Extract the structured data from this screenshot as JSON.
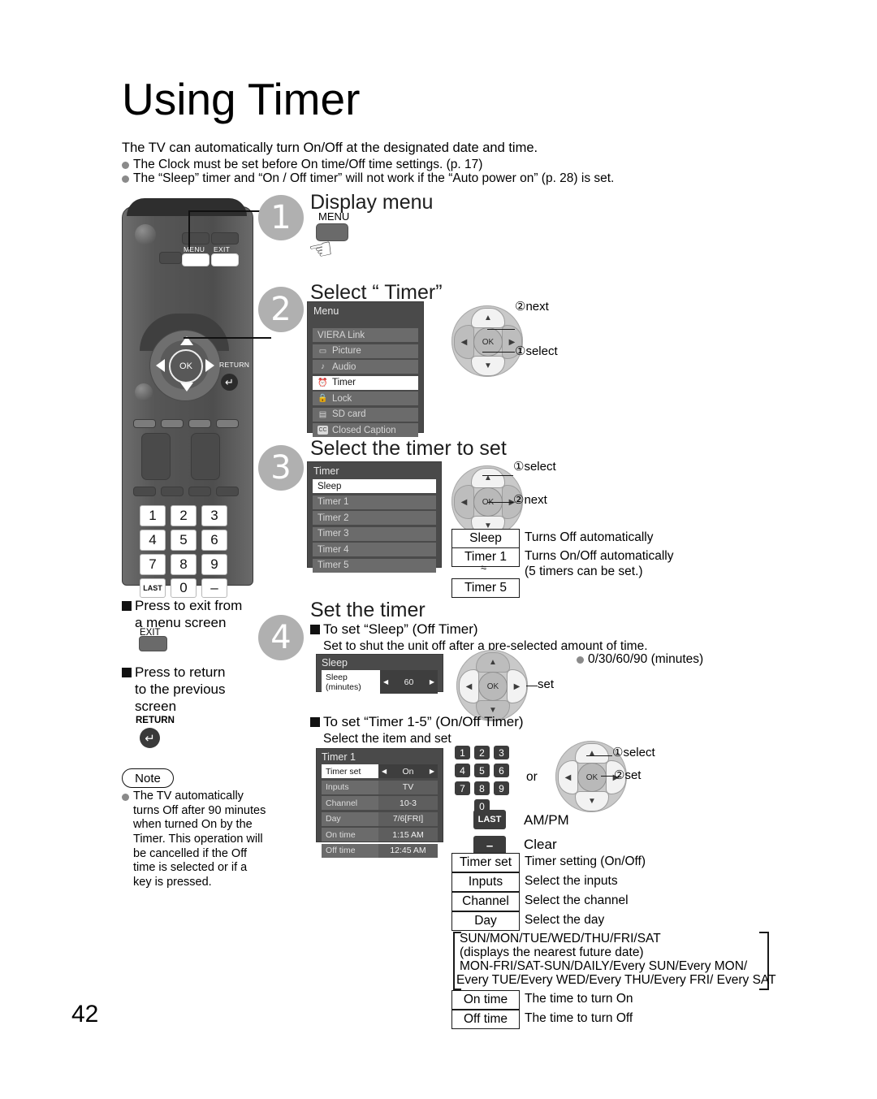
{
  "page": {
    "title": "Using Timer",
    "number": "42",
    "intro": "The TV can automatically turn On/Off at the designated date and time.",
    "intro_bullets": [
      "The Clock must be set before On time/Off time settings. (p. 17)",
      "The “Sleep” timer and “On / Off timer” will not work if the “Auto power on” (p. 28) is set."
    ]
  },
  "remote": {
    "menu_label": "MENU",
    "exit_label": "EXIT",
    "return_label": "RETURN",
    "ok_label": "OK",
    "keys": [
      "1",
      "2",
      "3",
      "4",
      "5",
      "6",
      "7",
      "8",
      "9",
      "LAST",
      "0",
      "–"
    ]
  },
  "steps": [
    {
      "num": "1",
      "title": "Display menu",
      "key_label": "MENU"
    },
    {
      "num": "2",
      "title": "Select “ Timer”"
    },
    {
      "num": "3",
      "title": "Select the timer to set"
    },
    {
      "num": "4",
      "title": "Set the timer"
    }
  ],
  "menu_osd": {
    "title": "Menu",
    "items": [
      {
        "icon": "",
        "label": "VIERA Link",
        "selected": false
      },
      {
        "icon": "▭",
        "label": "Picture",
        "selected": false
      },
      {
        "icon": "♪",
        "label": "Audio",
        "selected": false
      },
      {
        "icon": "⏱",
        "label": "Timer",
        "selected": true
      },
      {
        "icon": "ὑ2",
        "label": "Lock",
        "selected": false
      },
      {
        "icon": "▤",
        "label": "SD card",
        "selected": false
      },
      {
        "icon": "CC",
        "label": "Closed Caption",
        "selected": false
      }
    ]
  },
  "timer_osd": {
    "title": "Timer",
    "items": [
      {
        "label": "Sleep",
        "selected": true
      },
      {
        "label": "Timer 1",
        "selected": false
      },
      {
        "label": "Timer 2",
        "selected": false
      },
      {
        "label": "Timer 3",
        "selected": false
      },
      {
        "label": "Timer 4",
        "selected": false
      },
      {
        "label": "Timer 5",
        "selected": false
      }
    ]
  },
  "sleep_osd": {
    "title": "Sleep",
    "row_key": "Sleep (minutes)",
    "row_value": "60"
  },
  "timer1_osd": {
    "title": "Timer 1",
    "rows": [
      {
        "key": "Timer set",
        "value": "On",
        "selected": true
      },
      {
        "key": "Inputs",
        "value": "TV",
        "selected": false
      },
      {
        "key": "Channel",
        "value": "10-3",
        "selected": false
      },
      {
        "key": "Day",
        "value": "7/6[FRI]",
        "selected": false
      },
      {
        "key": "On time",
        "value": "1:15 AM",
        "selected": false
      },
      {
        "key": "Off time",
        "value": "12:45 AM",
        "selected": false
      }
    ]
  },
  "callouts": {
    "step2_next": "②next",
    "step2_select": "①select",
    "step3_select": "①select",
    "step3_next": "②next",
    "step4_set": "set",
    "step4_select": "①select",
    "step4_set2": "②set",
    "or": "or"
  },
  "timer_legend": [
    {
      "box": "Sleep",
      "desc": "Turns Off automatically"
    },
    {
      "box": "Timer 1",
      "desc": "Turns On/Off automatically"
    },
    {
      "box": "Timer 5",
      "desc": "(5 timers can be set.)"
    }
  ],
  "timer_legend_tilde": "≈",
  "sleep_section": {
    "heading": "To set “Sleep” (Off Timer)",
    "desc": "Set to shut the unit off after a pre-selected amount of time.",
    "bullet": "0/30/60/90 (minutes)"
  },
  "timer_section": {
    "heading": "To set “Timer 1-5” (On/Off Timer)",
    "desc": "Select the item and set",
    "keypad": [
      "1",
      "2",
      "3",
      "4",
      "5",
      "6",
      "7",
      "8",
      "9",
      "0"
    ],
    "last_key": "LAST",
    "last_desc": "AM/PM",
    "minus_key": "–",
    "minus_desc": "Clear"
  },
  "item_legend": [
    {
      "box": "Timer set",
      "desc": "Timer setting (On/Off)"
    },
    {
      "box": "Inputs",
      "desc": "Select the inputs"
    },
    {
      "box": "Channel",
      "desc": "Select the channel"
    },
    {
      "box": "Day",
      "desc": "Select the day"
    },
    {
      "box": "On time",
      "desc": "The time to turn On"
    },
    {
      "box": "Off time",
      "desc": "The time to turn Off"
    }
  ],
  "day_options": [
    "SUN/MON/TUE/WED/THU/FRI/SAT",
    "(displays the nearest future date)",
    "MON-FRI/SAT-SUN/DAILY/Every SUN/Every MON/",
    "Every TUE/Every WED/Every THU/Every FRI/ Every SAT"
  ],
  "left_notes": {
    "exit_heading_l1": "Press to exit from",
    "exit_heading_l2": "a menu screen",
    "exit_key": "EXIT",
    "return_heading_l1": "Press to return",
    "return_heading_l2": "to the previous",
    "return_heading_l3": "screen",
    "return_key": "RETURN",
    "note_label": "Note",
    "note_text": "The TV automatically turns Off after 90 minutes when turned On by the Timer. This operation will be cancelled if the Off time is selected or if a key is pressed."
  }
}
